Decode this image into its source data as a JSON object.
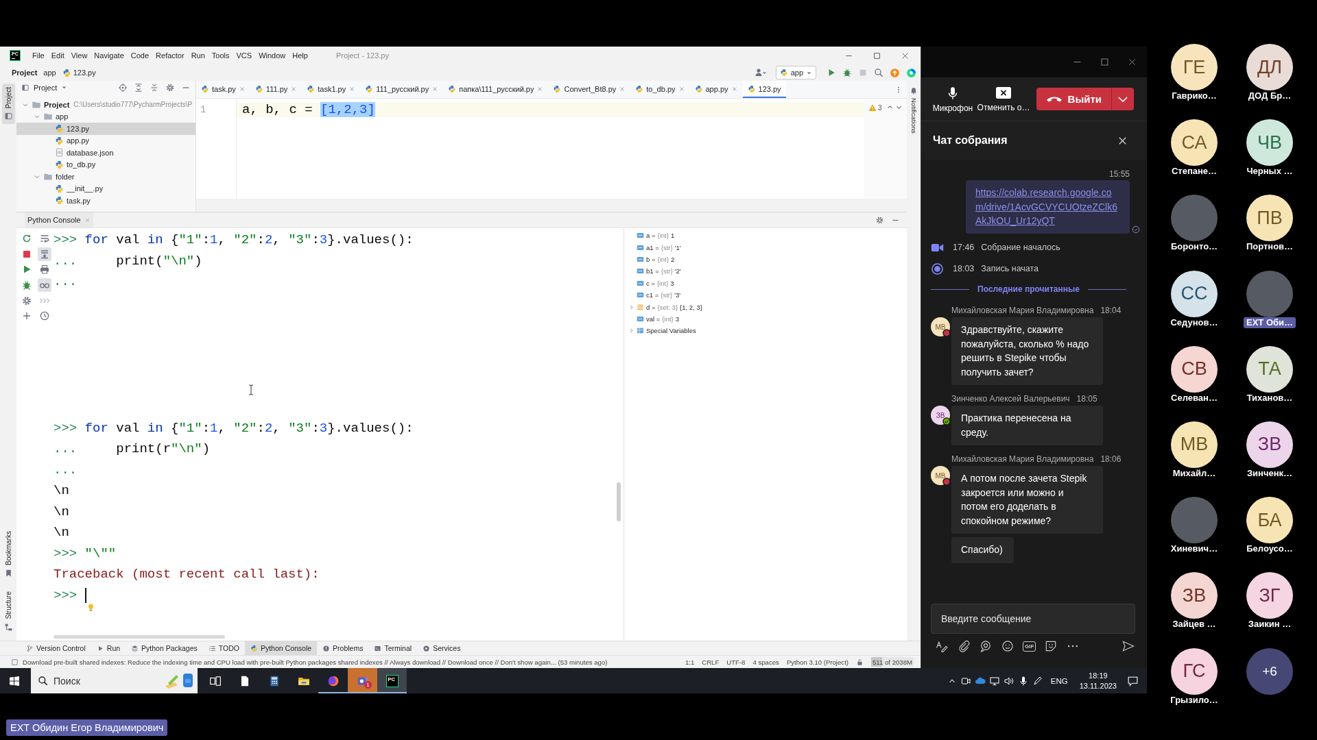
{
  "ide": {
    "logo": "PC",
    "menu": [
      "File",
      "Edit",
      "View",
      "Navigate",
      "Code",
      "Refactor",
      "Run",
      "Tools",
      "VCS",
      "Window",
      "Help"
    ],
    "title": "Project - 123.py",
    "breadcrumbs": [
      {
        "label": "Project",
        "kind": "root"
      },
      {
        "label": "app",
        "kind": "folder"
      },
      {
        "label": "123.py",
        "kind": "python"
      }
    ],
    "run_config": "app",
    "side_tabs": {
      "top": [
        {
          "label": "Project",
          "selected": true
        }
      ],
      "bottom": [
        {
          "label": "Bookmarks",
          "selected": false
        },
        {
          "label": "Structure",
          "selected": false
        }
      ]
    },
    "notifications_tab": "Notifications",
    "project_panel": {
      "title": "Project",
      "tree": [
        {
          "label": "Project",
          "path": "C:\\Users\\studio777\\PycharmProjects\\P",
          "kind": "root",
          "expanded": true,
          "selected": false,
          "children": [
            {
              "label": "app",
              "kind": "folder",
              "expanded": true,
              "selected": false,
              "children": [
                {
                  "label": "123.py",
                  "kind": "python",
                  "selected": true
                },
                {
                  "label": "app.py",
                  "kind": "python",
                  "selected": false
                },
                {
                  "label": "database.json",
                  "kind": "json",
                  "selected": false
                },
                {
                  "label": "to_db.py",
                  "kind": "python",
                  "selected": false
                }
              ]
            },
            {
              "label": "folder",
              "kind": "folder",
              "expanded": true,
              "selected": false,
              "children": [
                {
                  "label": "__init__.py",
                  "kind": "python",
                  "selected": false
                },
                {
                  "label": "task.py",
                  "kind": "python",
                  "selected": false
                }
              ]
            }
          ]
        }
      ]
    },
    "tabs": [
      {
        "label": "task.py",
        "selected": false
      },
      {
        "label": "111.py",
        "selected": false
      },
      {
        "label": "task1.py",
        "selected": false
      },
      {
        "label": "111_русский.py",
        "selected": false
      },
      {
        "label": "папка\\111_русский.py",
        "selected": false
      },
      {
        "label": "Convert_Bt8.py",
        "selected": false
      },
      {
        "label": "to_db.py",
        "selected": false
      },
      {
        "label": "app.py",
        "selected": false
      },
      {
        "label": "123.py",
        "selected": true
      }
    ],
    "editor": {
      "lines": [
        {
          "number": "1",
          "tokens": [
            {
              "kind": "plain",
              "text": "a, b, c = "
            },
            {
              "kind": "selection",
              "text": "[1,2,3]"
            }
          ]
        }
      ],
      "warnings": "3"
    },
    "console": {
      "title": "Python Console",
      "toolbar": [
        {
          "on": false
        },
        {
          "on": false
        },
        {
          "on": false
        },
        {
          "on": false
        },
        {
          "on": false
        },
        {
          "on": false
        },
        {
          "on": false
        },
        {
          "on": true
        },
        {
          "on": false
        },
        {
          "on": true
        },
        {
          "on": false
        },
        {
          "on": false
        }
      ],
      "blocks": [
        {
          "lines": [
            {
              "tokens": [
                {
                  "kind": "prompt",
                  "text": ">>> "
                },
                {
                  "kind": "keyword",
                  "text": "for"
                },
                {
                  "kind": "plain",
                  "text": " val "
                },
                {
                  "kind": "keyword",
                  "text": "in"
                },
                {
                  "kind": "plain",
                  "text": " {"
                },
                {
                  "kind": "string",
                  "text": "\"1\""
                },
                {
                  "kind": "plain",
                  "text": ":"
                },
                {
                  "kind": "number",
                  "text": "1"
                },
                {
                  "kind": "plain",
                  "text": ", "
                },
                {
                  "kind": "string",
                  "text": "\"2\""
                },
                {
                  "kind": "plain",
                  "text": ":"
                },
                {
                  "kind": "number",
                  "text": "2"
                },
                {
                  "kind": "plain",
                  "text": ", "
                },
                {
                  "kind": "string",
                  "text": "\"3\""
                },
                {
                  "kind": "plain",
                  "text": ":"
                },
                {
                  "kind": "number",
                  "text": "3"
                },
                {
                  "kind": "plain",
                  "text": "}.values():"
                }
              ]
            },
            {
              "tokens": [
                {
                  "kind": "prompt",
                  "text": "..."
                },
                {
                  "kind": "plain",
                  "text": "     print("
                },
                {
                  "kind": "string",
                  "text": "\"\\n\""
                },
                {
                  "kind": "plain",
                  "text": ")"
                }
              ]
            },
            {
              "tokens": [
                {
                  "kind": "prompt",
                  "text": "..."
                }
              ]
            }
          ]
        },
        {
          "lines": [
            {
              "tokens": [
                {
                  "kind": "prompt",
                  "text": ">>> "
                },
                {
                  "kind": "keyword",
                  "text": "for"
                },
                {
                  "kind": "plain",
                  "text": " val "
                },
                {
                  "kind": "keyword",
                  "text": "in"
                },
                {
                  "kind": "plain",
                  "text": " {"
                },
                {
                  "kind": "string",
                  "text": "\"1\""
                },
                {
                  "kind": "plain",
                  "text": ":"
                },
                {
                  "kind": "number",
                  "text": "1"
                },
                {
                  "kind": "plain",
                  "text": ", "
                },
                {
                  "kind": "string",
                  "text": "\"2\""
                },
                {
                  "kind": "plain",
                  "text": ":"
                },
                {
                  "kind": "number",
                  "text": "2"
                },
                {
                  "kind": "plain",
                  "text": ", "
                },
                {
                  "kind": "string",
                  "text": "\"3\""
                },
                {
                  "kind": "plain",
                  "text": ":"
                },
                {
                  "kind": "number",
                  "text": "3"
                },
                {
                  "kind": "plain",
                  "text": "}.values():"
                }
              ]
            },
            {
              "tokens": [
                {
                  "kind": "prompt",
                  "text": "..."
                },
                {
                  "kind": "plain",
                  "text": "     print(r"
                },
                {
                  "kind": "string",
                  "text": "\"\\n\""
                },
                {
                  "kind": "plain",
                  "text": ")"
                }
              ]
            },
            {
              "tokens": [
                {
                  "kind": "prompt",
                  "text": "..."
                }
              ]
            },
            {
              "tokens": [
                {
                  "kind": "output",
                  "text": "\\n"
                }
              ]
            },
            {
              "tokens": [
                {
                  "kind": "output",
                  "text": "\\n"
                }
              ]
            },
            {
              "tokens": [
                {
                  "kind": "output",
                  "text": "\\n"
                }
              ]
            },
            {
              "tokens": [
                {
                  "kind": "prompt",
                  "text": ">>> "
                },
                {
                  "kind": "string",
                  "text": "\"\\\"\""
                }
              ]
            },
            {
              "tokens": [
                {
                  "kind": "error",
                  "text": "Traceback (most recent call last):"
                }
              ]
            }
          ]
        }
      ],
      "input": {
        "prompt": ">>>",
        "focused": true
      }
    },
    "variables": [
      {
        "kind": "value",
        "name": "a =",
        "type": "{int}",
        "value": "1"
      },
      {
        "kind": "value",
        "name": "a1 =",
        "type": "{str}",
        "value": "'1'"
      },
      {
        "kind": "value",
        "name": "b =",
        "type": "{int}",
        "value": "2"
      },
      {
        "kind": "value",
        "name": "b1 =",
        "type": "{str}",
        "value": "'2'"
      },
      {
        "kind": "value",
        "name": "c =",
        "type": "{int}",
        "value": "3"
      },
      {
        "kind": "value",
        "name": "c1 =",
        "type": "{str}",
        "value": "'3'"
      },
      {
        "kind": "collection",
        "name": "d =",
        "type": "{set: 3}",
        "value": "{1, 2, 3}",
        "expanded": false
      },
      {
        "kind": "value",
        "name": "val =",
        "type": "{int}",
        "value": "3"
      },
      {
        "kind": "special",
        "name": "Special Variables",
        "expanded": false
      }
    ],
    "tool_tabs": [
      {
        "label": "Version Control",
        "selected": false
      },
      {
        "label": "Run",
        "selected": false
      },
      {
        "label": "Python Packages",
        "selected": false
      },
      {
        "label": "TODO",
        "selected": false
      },
      {
        "label": "Python Console",
        "selected": true
      },
      {
        "label": "Problems",
        "selected": false
      },
      {
        "label": "Terminal",
        "selected": false
      },
      {
        "label": "Services",
        "selected": false
      }
    ],
    "status_bar": {
      "message": "Download pre-built shared indexes: Reduce the indexing time and CPU load with pre-built Python packages shared indexes // Always download // Download once // Don't show again... (53 minutes ago)",
      "items": [
        "1:1",
        "CRLF",
        "UTF-8",
        "4 spaces",
        "Python 3.10 (Project)"
      ],
      "memory": {
        "text": "511 of 2038M",
        "level": 0.25
      }
    }
  },
  "meeting": {
    "controls": [
      {
        "kind": "mic",
        "label": "Микрофон"
      },
      {
        "kind": "share",
        "label": "Отменить о…"
      }
    ],
    "leave": {
      "label": "Выйти"
    },
    "chat": {
      "title": "Чат собрания",
      "items": [
        {
          "kind": "own",
          "time": "15:55",
          "link": "https://colab.research.google.com/drive/1AcvGCVYCUOtzeZClk6AkJkOU_Ur12yQT"
        },
        {
          "kind": "meeting",
          "time": "17:46",
          "text": "Собрание началось"
        },
        {
          "kind": "recording",
          "time": "18:03",
          "text": "Запись начата"
        },
        {
          "kind": "divider",
          "text": "Последние прочитанные"
        },
        {
          "kind": "message",
          "sender": "Михайловская Мария Владимировна",
          "time": "18:04",
          "initials": "МВ",
          "color": "#f7e4bd",
          "available": false,
          "bubbles": [
            "Здравствуйте, скажите пожалуйста, сколько % надо решить в Stepike чтобы получить зачет?"
          ]
        },
        {
          "kind": "message",
          "sender": "Зинченко Алексей Валерьевич",
          "time": "18:05",
          "initials": "ЗВ",
          "color": "#ecd6ec",
          "available": true,
          "bubbles": [
            "Практика перенесена на среду."
          ]
        },
        {
          "kind": "message",
          "sender": "Михайловская Мария Владимировна",
          "time": "18:06",
          "initials": "МВ",
          "color": "#f7e4bd",
          "available": false,
          "bubbles": [
            "А потом после зачета Stepik закроется или можно и потом его доделать в спокойном режиме?",
            "Спасибо)"
          ]
        }
      ]
    },
    "composer": {
      "placeholder": "Введите сообщение",
      "gif_label": "GIF"
    }
  },
  "participant_grid": {
    "rows": [
      {
        "tiles": [
          {
            "kind": "initials",
            "initials": "ГЕ",
            "name": "Гаврико…",
            "color": "#f7e4bd",
            "highlighted": false
          },
          {
            "kind": "initials",
            "initials": "ДЛ",
            "name": "ДОД Бр…",
            "color": "#e9dcd6",
            "highlighted": false
          }
        ]
      },
      {
        "tiles": [
          {
            "kind": "initials",
            "initials": "СА",
            "name": "Степане…",
            "color": "#f7e4b5",
            "highlighted": false
          },
          {
            "kind": "initials",
            "initials": "ЧВ",
            "name": "Черных …",
            "color": "#cfe8dc",
            "highlighted": false
          }
        ]
      },
      {
        "tiles": [
          {
            "kind": "photo",
            "name": "Боронто…",
            "highlighted": false
          },
          {
            "kind": "initials",
            "initials": "ПВ",
            "name": "Портнов…",
            "color": "#f7e4b5",
            "highlighted": false
          }
        ]
      },
      {
        "tiles": [
          {
            "kind": "initials",
            "initials": "СС",
            "name": "Седунов…",
            "color": "#d5e2ea",
            "highlighted": false
          },
          {
            "kind": "photo",
            "name": "EXT Оби…",
            "highlighted": true
          }
        ]
      },
      {
        "tiles": [
          {
            "kind": "initials",
            "initials": "СВ",
            "name": "Селеван…",
            "color": "#f5d6d2",
            "highlighted": false
          },
          {
            "kind": "initials",
            "initials": "ТА",
            "name": "Тиханов…",
            "color": "#dfe3d9",
            "highlighted": false
          }
        ]
      },
      {
        "tiles": [
          {
            "kind": "initials",
            "initials": "МВ",
            "name": "Михайл…",
            "color": "#f7e4b5",
            "highlighted": false
          },
          {
            "kind": "initials",
            "initials": "ЗВ",
            "name": "Зинченк…",
            "color": "#ecd5ea",
            "highlighted": false
          }
        ]
      },
      {
        "tiles": [
          {
            "kind": "photo",
            "name": "Хиневич…",
            "highlighted": false
          },
          {
            "kind": "initials",
            "initials": "БА",
            "name": "Белоусо…",
            "color": "#f7e4b5",
            "highlighted": false
          }
        ]
      },
      {
        "tiles": [
          {
            "kind": "initials",
            "initials": "ЗВ",
            "name": "Зайцев …",
            "color": "#f3d6d1",
            "highlighted": false
          },
          {
            "kind": "initials",
            "initials": "ЗГ",
            "name": "Заикин …",
            "color": "#f5d5e2",
            "highlighted": false
          }
        ]
      },
      {
        "tiles": [
          {
            "kind": "initials",
            "initials": "ГС",
            "name": "Грызило…",
            "color": "#f6d3df",
            "highlighted": false
          },
          {
            "kind": "overflow",
            "initials": "+6",
            "color": "#464775"
          }
        ]
      }
    ]
  },
  "taskbar": {
    "search": {
      "placeholder": "Поиск"
    },
    "apps": [
      {
        "running": false,
        "flashing": false,
        "active": false
      },
      {
        "running": false,
        "flashing": false,
        "active": false
      },
      {
        "running": false,
        "flashing": false,
        "active": false
      },
      {
        "running": false,
        "flashing": false,
        "active": false
      },
      {
        "running": true,
        "flashing": false,
        "active": false
      },
      {
        "running": true,
        "flashing": true,
        "active": false,
        "badge": "1"
      },
      {
        "running": true,
        "flashing": false,
        "active": true,
        "logo": "PC"
      }
    ],
    "language": "ENG",
    "time": "18:19",
    "date": "13.11.2023"
  },
  "presenter_label": "EXT Обидин Егор Владимирович"
}
